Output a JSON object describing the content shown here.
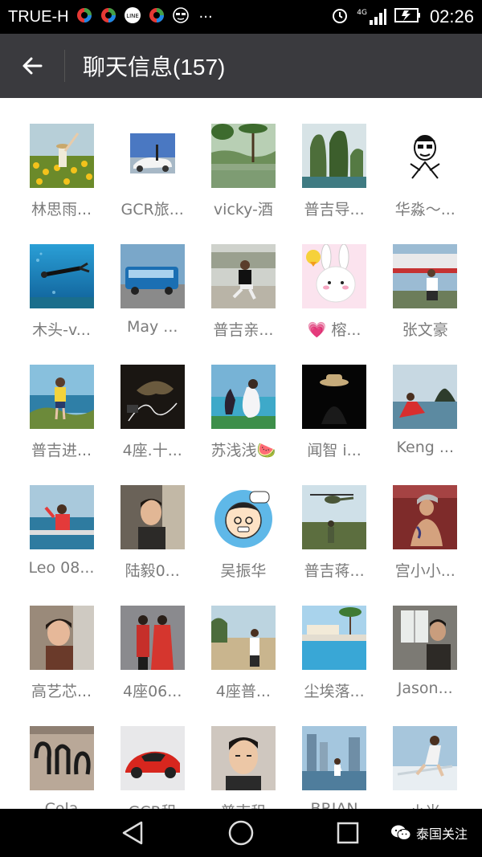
{
  "status_bar": {
    "carrier": "TRUE-H",
    "network": "4G",
    "time": "02:26",
    "more": "···",
    "line_badge": "LINE"
  },
  "header": {
    "title": "聊天信息(157)"
  },
  "members": [
    {
      "name": "林思雨...",
      "avatar": "sunflower-field"
    },
    {
      "name": "GCR旅...",
      "avatar": "car-photo"
    },
    {
      "name": "vicky-酒",
      "avatar": "tropical-lake"
    },
    {
      "name": "普吉导...",
      "avatar": "limestone-island"
    },
    {
      "name": "华淼～...",
      "avatar": "cartoon-sketch"
    },
    {
      "name": "木头-v...",
      "avatar": "scuba-diver"
    },
    {
      "name": "May ...",
      "avatar": "bus"
    },
    {
      "name": "普吉亲...",
      "avatar": "man-sitting"
    },
    {
      "name": "💗 榕...",
      "avatar": "line-bunny"
    },
    {
      "name": "张文豪",
      "avatar": "man-by-plane"
    },
    {
      "name": "普吉进...",
      "avatar": "man-on-rocks"
    },
    {
      "name": "4座.十...",
      "avatar": "earphones-hat"
    },
    {
      "name": "苏浅浅🍉",
      "avatar": "woman-with-horse"
    },
    {
      "name": "闻智 i...",
      "avatar": "man-in-hat"
    },
    {
      "name": "Keng ...",
      "avatar": "man-at-sea"
    },
    {
      "name": "Leo 08...",
      "avatar": "man-on-boat"
    },
    {
      "name": "陆毅0...",
      "avatar": "man-in-car"
    },
    {
      "name": "吴振华",
      "avatar": "cartoon-face"
    },
    {
      "name": "普吉蒋...",
      "avatar": "helicopter"
    },
    {
      "name": "宫小小...",
      "avatar": "tattoo-man"
    },
    {
      "name": "高艺芯...",
      "avatar": "woman-in-car"
    },
    {
      "name": "4座06...",
      "avatar": "wedding-couple"
    },
    {
      "name": "4座普...",
      "avatar": "man-at-beach"
    },
    {
      "name": "尘埃落...",
      "avatar": "pool"
    },
    {
      "name": "Jason...",
      "avatar": "man-by-window"
    },
    {
      "name": "Cola",
      "avatar": "thai-script"
    },
    {
      "name": "GCR租",
      "avatar": "red-sportscar"
    },
    {
      "name": "普吉租",
      "avatar": "man-selfie"
    },
    {
      "name": "BRIAN",
      "avatar": "city-fountain"
    },
    {
      "name": "小米",
      "avatar": "yacht-man"
    }
  ],
  "navigation": {
    "back": "back",
    "home": "home",
    "recent": "recent"
  },
  "watermark": {
    "text": "泰国关注"
  }
}
